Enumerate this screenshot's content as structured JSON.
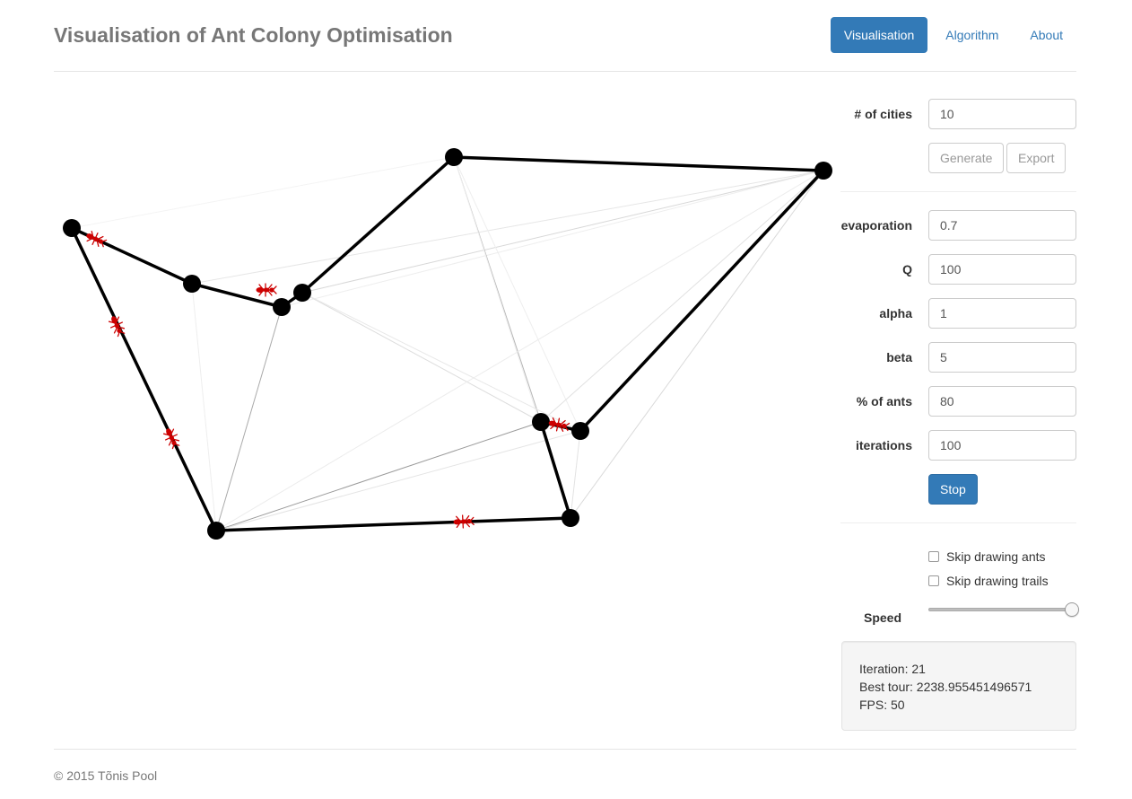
{
  "app": {
    "title": "Visualisation of Ant Colony Optimisation"
  },
  "nav": {
    "items": [
      {
        "label": "Visualisation",
        "active": true
      },
      {
        "label": "Algorithm",
        "active": false
      },
      {
        "label": "About",
        "active": false
      }
    ]
  },
  "controls": {
    "cities": {
      "label": "# of cities",
      "value": "10"
    },
    "generate_label": "Generate",
    "export_label": "Export",
    "evaporation": {
      "label": "evaporation",
      "value": "0.7"
    },
    "q": {
      "label": "Q",
      "value": "100"
    },
    "alpha": {
      "label": "alpha",
      "value": "1"
    },
    "beta": {
      "label": "beta",
      "value": "5"
    },
    "ants": {
      "label": "% of ants",
      "value": "80"
    },
    "iterations": {
      "label": "iterations",
      "value": "100"
    },
    "stop_label": "Stop",
    "skip_ants_label": "Skip drawing ants",
    "skip_ants_checked": false,
    "skip_trails_label": "Skip drawing trails",
    "skip_trails_checked": false,
    "speed": {
      "label": "Speed",
      "level": 1.0
    }
  },
  "stats": {
    "iteration": "Iteration: 21",
    "best_tour": "Best tour: 2238.955451496571",
    "fps": "FPS: 50"
  },
  "footer": {
    "text": "© 2015 Tõnis Pool"
  },
  "colors": {
    "accent": "#337ab7",
    "city": "#000000",
    "best_tour": "#000000",
    "trail": "#9a9a9a",
    "ant": "#cc0000"
  },
  "icons": {
    "city": "black-dot",
    "ant": "red-ant-icon"
  }
}
